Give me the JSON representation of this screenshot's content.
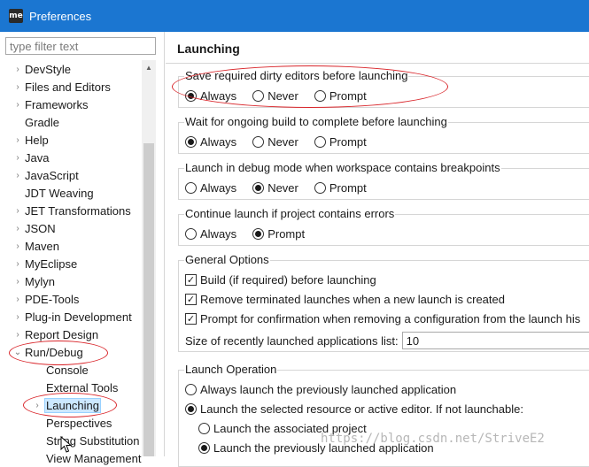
{
  "window": {
    "title": "Preferences",
    "app_icon_text": "me"
  },
  "filter": {
    "placeholder": "type filter text"
  },
  "tree": {
    "items": [
      {
        "label": "DevStyle",
        "expandable": true
      },
      {
        "label": "Files and Editors",
        "expandable": true
      },
      {
        "label": "Frameworks",
        "expandable": true
      },
      {
        "label": "Gradle",
        "expandable": false
      },
      {
        "label": "Help",
        "expandable": true
      },
      {
        "label": "Java",
        "expandable": true
      },
      {
        "label": "JavaScript",
        "expandable": true
      },
      {
        "label": "JDT Weaving",
        "expandable": false
      },
      {
        "label": "JET Transformations",
        "expandable": true
      },
      {
        "label": "JSON",
        "expandable": true
      },
      {
        "label": "Maven",
        "expandable": true
      },
      {
        "label": "MyEclipse",
        "expandable": true
      },
      {
        "label": "Mylyn",
        "expandable": true
      },
      {
        "label": "PDE-Tools",
        "expandable": true
      },
      {
        "label": "Plug-in Development",
        "expandable": true
      },
      {
        "label": "Report Design",
        "expandable": true
      },
      {
        "label": "Run/Debug",
        "expanded": true
      },
      {
        "label": "Console",
        "child": true
      },
      {
        "label": "External Tools",
        "child": true
      },
      {
        "label": "Launching",
        "child": true,
        "selected": true,
        "expandable": true
      },
      {
        "label": "Perspectives",
        "child": true
      },
      {
        "label": "String Substitution",
        "child": true
      },
      {
        "label": "View Management",
        "child": true
      }
    ]
  },
  "page": {
    "title": "Launching",
    "save_dirty": {
      "title": "Save required dirty editors before launching",
      "options": [
        "Always",
        "Never",
        "Prompt"
      ],
      "selected": "Always"
    },
    "wait_build": {
      "title": "Wait for ongoing build to complete before launching",
      "options": [
        "Always",
        "Never",
        "Prompt"
      ],
      "selected": "Always"
    },
    "debug_mode": {
      "title": "Launch in debug mode when workspace contains breakpoints",
      "options": [
        "Always",
        "Never",
        "Prompt"
      ],
      "selected": "Never"
    },
    "continue_errors": {
      "title": "Continue launch if project contains errors",
      "options": [
        "Always",
        "Prompt"
      ],
      "selected": "Prompt"
    },
    "general": {
      "title": "General Options",
      "checks": [
        {
          "label": "Build (if required) before launching",
          "checked": true
        },
        {
          "label": "Remove terminated launches when a new launch is created",
          "checked": true
        },
        {
          "label": "Prompt for confirmation when removing a configuration from the launch his",
          "checked": true
        }
      ],
      "size_label": "Size of recently launched applications list:",
      "size_value": "10"
    },
    "launch_op": {
      "title": "Launch Operation",
      "opt_previous": "Always launch the previously launched application",
      "opt_selected": "Launch the selected resource or active editor. If not launchable:",
      "sub_associated": "Launch the associated project",
      "sub_previous": "Launch the previously launched application",
      "selected": "opt_selected",
      "sub_selected": "sub_previous"
    }
  },
  "watermark": "https://blog.csdn.net/StriveE2",
  "colors": {
    "titlebar": "#1b76d1",
    "annotation": "#d9262b",
    "selection": "#cce8ff"
  }
}
